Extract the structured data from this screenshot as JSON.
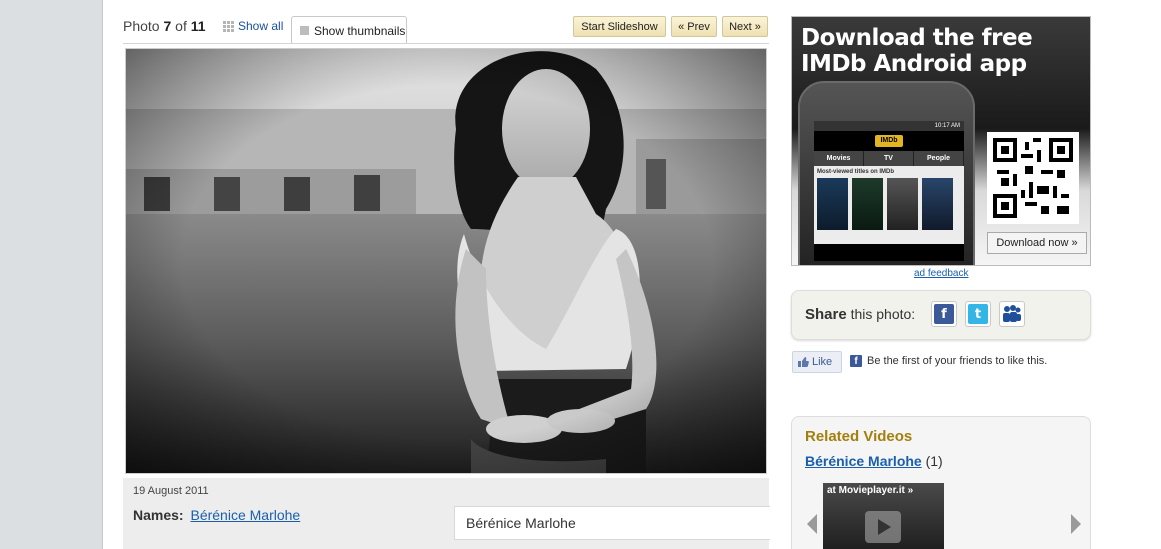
{
  "photo_nav": {
    "prefix": "Photo",
    "current": "7",
    "of_word": "of",
    "total": "11",
    "show_all": "Show all",
    "show_thumbnails": "Show thumbnails",
    "start_slideshow": "Start Slideshow",
    "prev": "« Prev",
    "next": "Next »"
  },
  "caption": {
    "date": "19 August 2011",
    "names_label": "Names:",
    "names_link": "Bérénice Marlohe",
    "name_box": "Bérénice Marlohe"
  },
  "ad": {
    "title_line1": "Download the free",
    "title_line2": "IMDb Android app",
    "status_time": "10:17 AM",
    "app_logo": "IMDb",
    "tabs": [
      "Movies",
      "TV",
      "People"
    ],
    "most_viewed": "Most-viewed titles on IMDb",
    "download_button": "Download now »",
    "feedback": "ad feedback"
  },
  "share": {
    "label_bold": "Share",
    "label_rest": "this photo:",
    "icons": [
      "facebook-icon",
      "twitter-icon",
      "myspace-icon"
    ],
    "colors": {
      "facebook": "#3b5998",
      "twitter": "#33b5e5",
      "myspace": "#1f4f9a"
    }
  },
  "like": {
    "button": "Like",
    "text": "Be the first of your friends to like this."
  },
  "related": {
    "title": "Related Videos",
    "link": "Bérénice Marlohe",
    "count": "(1)",
    "video_source": "at Movieplayer.it »"
  },
  "colors": {
    "link": "#1a5fae",
    "related_title": "#a3800d",
    "button_bg": "#f3e7bd"
  }
}
